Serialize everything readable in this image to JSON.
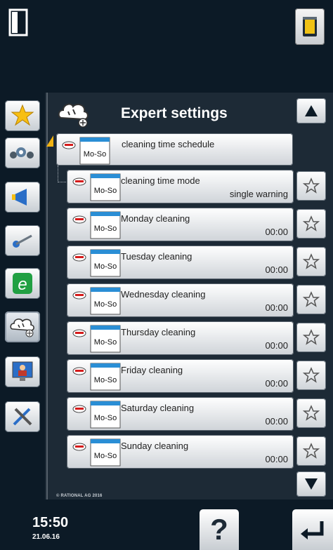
{
  "header": {
    "title": "Expert settings"
  },
  "sidebar": {
    "items": [
      {
        "icon": "star-icon",
        "label": ""
      },
      {
        "icon": "gauges-icon",
        "label": ""
      },
      {
        "icon": "megaphone-icon",
        "label": ""
      },
      {
        "icon": "tools-icon",
        "label": ""
      },
      {
        "icon": "efficiency-e-icon",
        "label": ""
      },
      {
        "icon": "expert-settings-icon",
        "label": ""
      },
      {
        "icon": "user-monitor-icon",
        "label": ""
      },
      {
        "icon": "service-tools-icon",
        "label": ""
      }
    ]
  },
  "schedule": {
    "icon_text": "Mo-So",
    "parent": {
      "label": "cleaning time schedule"
    },
    "items": [
      {
        "label": "cleaning time mode",
        "value": "single warning"
      },
      {
        "label": "Monday cleaning",
        "value": "00:00"
      },
      {
        "label": "Tuesday cleaning",
        "value": "00:00"
      },
      {
        "label": "Wednesday cleaning",
        "value": "00:00"
      },
      {
        "label": "Thursday cleaning",
        "value": "00:00"
      },
      {
        "label": "Friday cleaning",
        "value": "00:00"
      },
      {
        "label": "Saturday cleaning",
        "value": "00:00"
      },
      {
        "label": "Sunday cleaning",
        "value": "00:00"
      }
    ]
  },
  "footer": {
    "copyright": "© RATIONAL AG 2016",
    "time": "15:50",
    "date": "21.06.16",
    "help_label": "?"
  },
  "colors": {
    "background": "#0c1a26",
    "panel": "#1d2a36",
    "accent": "#f2b211",
    "warning": "#d51b1b"
  }
}
